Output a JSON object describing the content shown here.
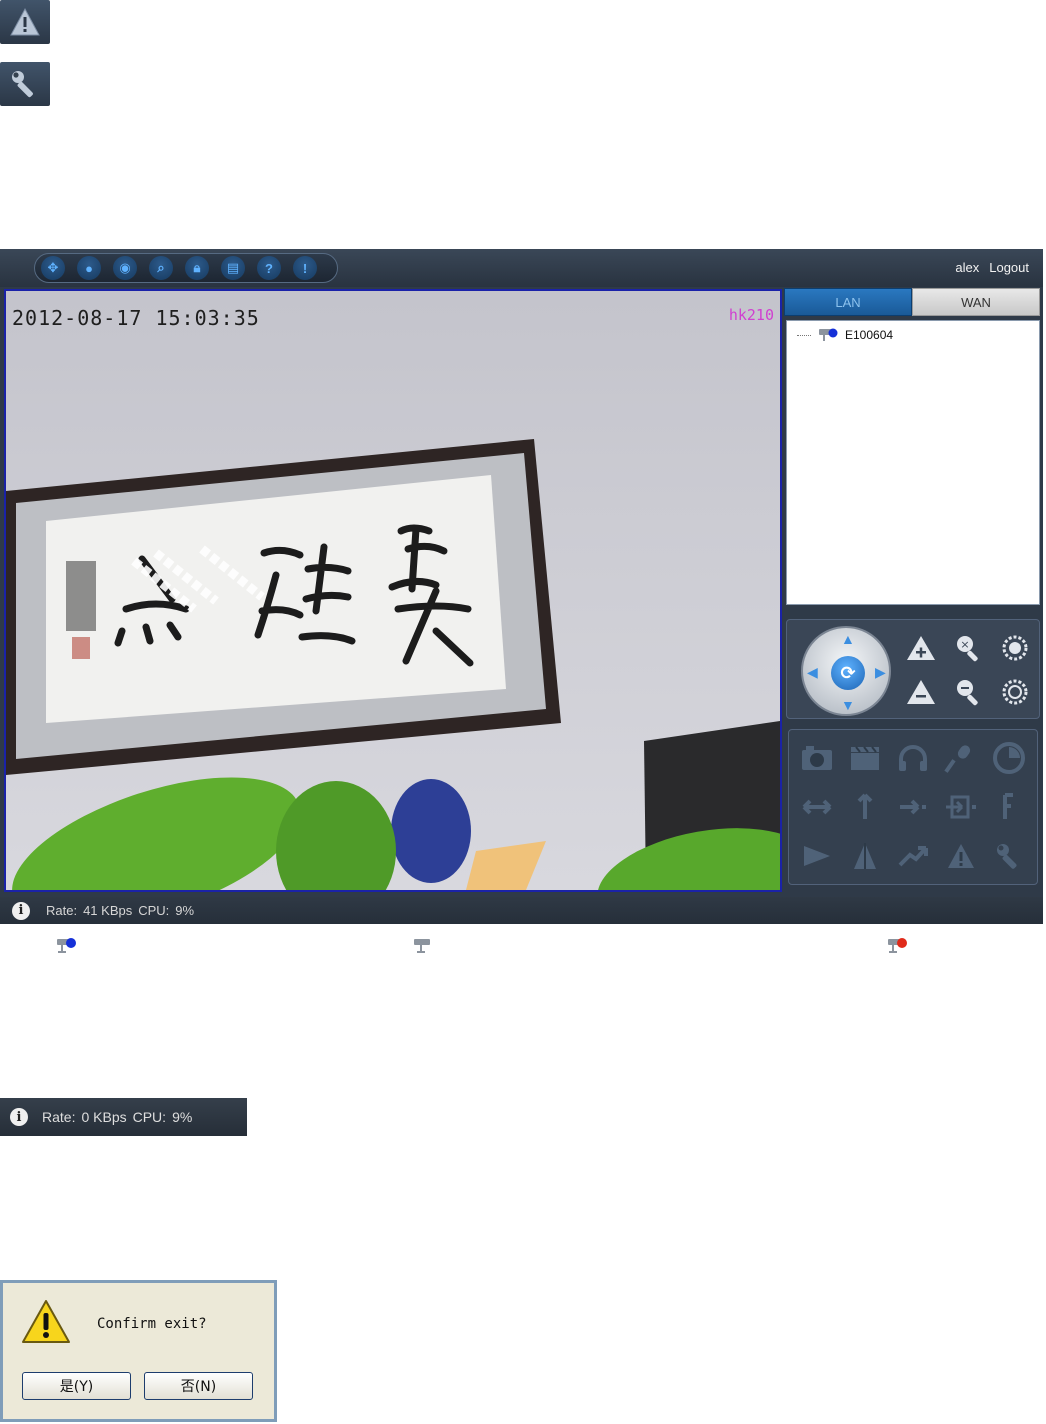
{
  "icons_top": {
    "warning_icon": "warning-triangle",
    "settings_icon": "wrench"
  },
  "window": {
    "toolbar": [
      "fullscreen",
      "record",
      "snapshot",
      "search",
      "lock",
      "storage",
      "help",
      "about"
    ],
    "user": {
      "name": "alex",
      "logout_label": "Logout"
    },
    "video": {
      "timestamp": "2012-08-17 15:03:35",
      "device_label": "hk210"
    },
    "tabs": {
      "lan": "LAN",
      "wan": "WAN"
    },
    "devices": [
      {
        "name": "E100604",
        "status": "online"
      }
    ],
    "ptz": {
      "dial": [
        "up",
        "down",
        "left",
        "right",
        "auto-rotate"
      ],
      "side_buttons": [
        "focus-plus",
        "zoom-in",
        "brightness-plus",
        "focus-minus",
        "zoom-out",
        "brightness-minus"
      ]
    },
    "functions": [
      "camera",
      "video-clip",
      "headphones",
      "microphone",
      "timer",
      "horizontal-scan",
      "vertical-scan",
      "preset-call",
      "preset-set",
      "preset-clear",
      "flip",
      "mirror",
      "trend",
      "alarm",
      "settings"
    ],
    "status": {
      "rate_label": "Rate:",
      "rate_value": "41 KBps",
      "cpu_label": "CPU:",
      "cpu_value": "9%"
    }
  },
  "legend_icons": [
    "camera-online-blue",
    "camera-offline-gray",
    "camera-alarm-red"
  ],
  "status_strip": {
    "rate_label": "Rate:",
    "rate_value": "0 KBps",
    "cpu_label": "CPU:",
    "cpu_value": "9%"
  },
  "dialog": {
    "message": "Confirm exit?",
    "yes_label": "是(Y)",
    "no_label": "否(N)"
  },
  "colors": {
    "frame_dark": "#2f3a48",
    "accent_blue": "#1a22a8",
    "osd_magenta": "#d040d0",
    "lan_tab": "#1a5a98"
  }
}
